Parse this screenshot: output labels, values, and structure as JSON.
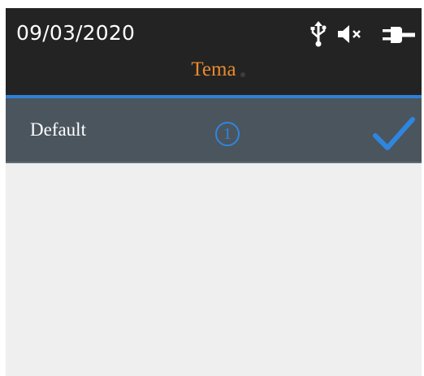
{
  "status_bar": {
    "date": "09/03/2020",
    "icons": [
      "usb-icon",
      "speaker-muted-icon",
      "power-plug-icon"
    ]
  },
  "header": {
    "title": "Tema"
  },
  "list": {
    "items": [
      {
        "label": "Default",
        "callout": "1",
        "selected": true
      }
    ]
  },
  "colors": {
    "header_bg": "#232323",
    "title": "#e98a2c",
    "accent": "#2f7fd6",
    "row_bg": "#4b555d",
    "content_bg": "#efefef",
    "check": "#2f86e0"
  }
}
